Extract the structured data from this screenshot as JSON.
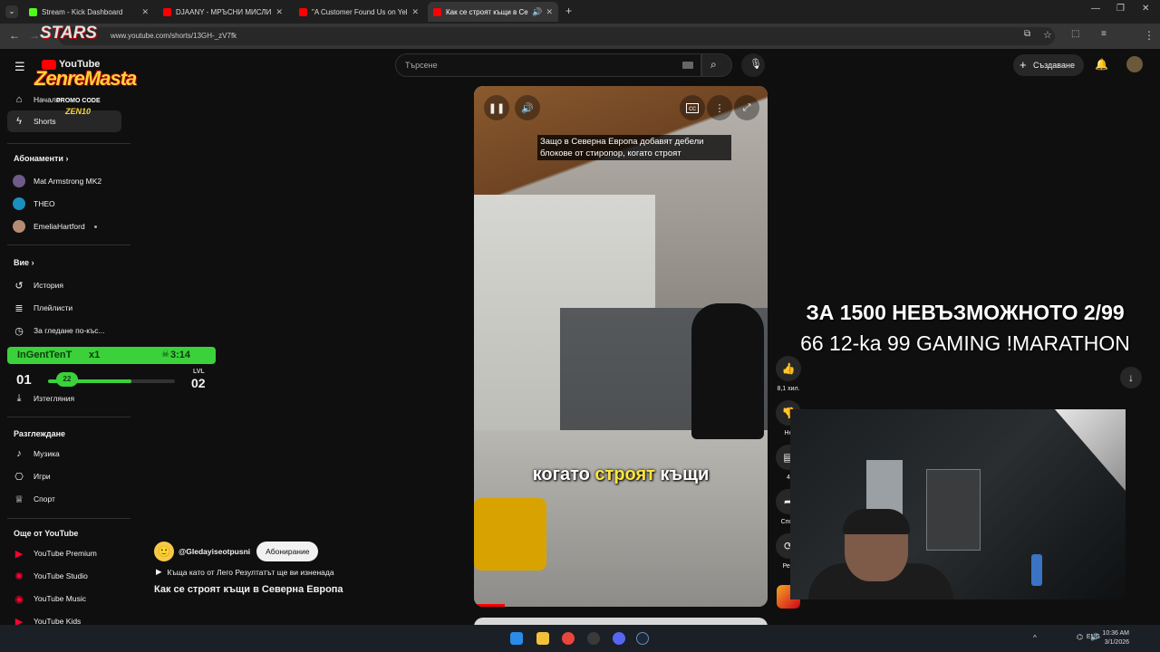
{
  "browser": {
    "tabs": [
      {
        "title": "Stream - Kick Dashboard",
        "color": "#53fc18"
      },
      {
        "title": "DJAANY - МРЪСНИ МИСЛИ (",
        "color": "#ff0000"
      },
      {
        "title": "\"A Customer Found Us on Yelp",
        "color": "#ff0000"
      },
      {
        "title": "Как се строят къщи в Севе",
        "color": "#ff0000"
      }
    ],
    "url": "www.youtube.com/shorts/13GH-_zV7fk"
  },
  "youtube": {
    "search_placeholder": "Търсене",
    "create_label": "Създаване",
    "logo_text": "YouTube"
  },
  "sidebar": {
    "home": "Начало",
    "shorts": "Shorts",
    "subscriptions_header": "Абонаменти",
    "subscriptions": [
      {
        "name": "Mat Armstrong MK2",
        "color": "#6f5b8a"
      },
      {
        "name": "THEO",
        "color": "#1b8fbf"
      },
      {
        "name": "EmeliaHartford",
        "color": "#b58c73"
      }
    ],
    "you_header": "Вие",
    "you_items": [
      "История",
      "Плейлисти",
      "За гледане по-къс...",
      "Изтегляния"
    ],
    "explore_header": "Разглеждане",
    "explore_items": [
      "Музика",
      "Игри",
      "Спорт"
    ],
    "more_header": "Още от YouTube",
    "more_items": [
      "YouTube Premium",
      "YouTube Studio",
      "YouTube Music",
      "YouTube Kids"
    ]
  },
  "short": {
    "caption_top": "Защо в Северна Европа добавят дебели блокове от стиропор, когато строят",
    "caption_bottom_pre": "когато ",
    "caption_bottom_hl": "строят",
    "caption_bottom_post": " къщи",
    "channel": "@Gledayiseotpusni",
    "subscribe": "Абонирание",
    "music": "Къща като от Лего Резултатът ще ви изненада",
    "title": "Как се строят къщи в Северна Европа",
    "likes": "8,1 хил.",
    "dislike_label": "Не",
    "comments_count": "4",
    "share_label": "Спод",
    "remix_label": "Рем"
  },
  "stream_overlay": {
    "line1": "ЗА 1500 НЕВЪЗМОЖНОТО 2/99",
    "line2": "66 12-ka 99 GAMING !MARATHON",
    "hud_name": "InGentTenT",
    "hud_multiplier": "x1",
    "hud_time": "3:14",
    "hud_level_current": "01",
    "hud_level_badge": "22",
    "hud_level_cap": "LVL",
    "hud_level_next": "02",
    "hud_progress": 0.66,
    "brand_text": "STARS",
    "brand_text2": "ZenreMasta",
    "promo_label": "PROMO CODE",
    "promo_code": "ZEN10"
  },
  "taskbar": {
    "lang": "ENG",
    "time": "10:36 AM",
    "date": "3/1/2026"
  }
}
